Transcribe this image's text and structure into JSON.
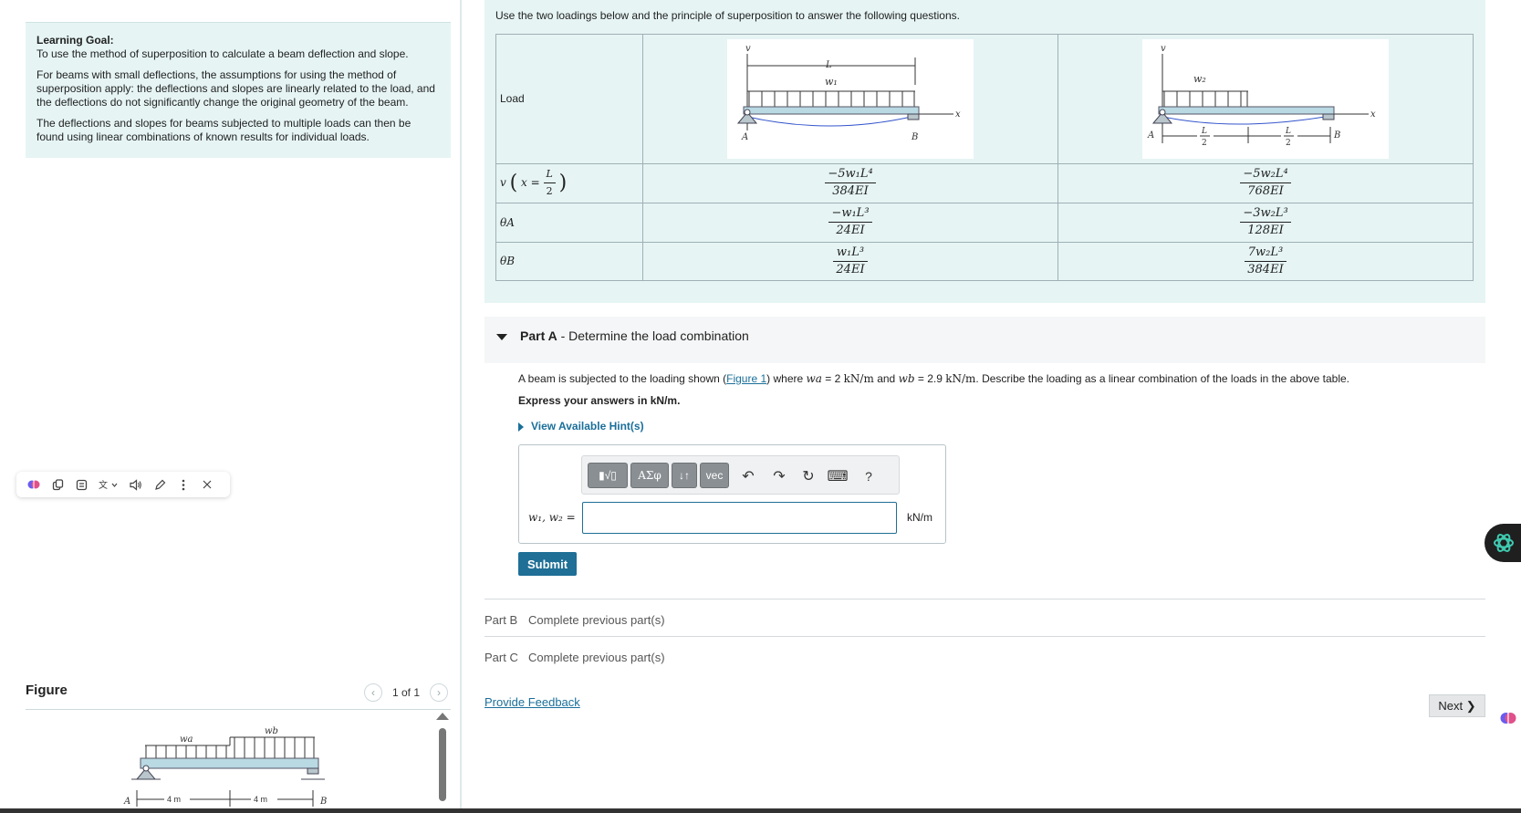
{
  "learning_goal": {
    "title": "Learning Goal:",
    "line1": "To use the method of superposition to calculate a beam deflection and slope.",
    "para2": "For beams with small deflections, the assumptions for using the method of superposition apply: the deflections and slopes are linearly related to the load, and the deflections do not significantly change the original geometry of the beam.",
    "para3": "The deflections and slopes for beams subjected to multiple loads can then be found using linear combinations of known results for individual loads."
  },
  "figure_panel": {
    "title": "Figure",
    "pager": "1 of 1",
    "prev_icon": "‹",
    "next_icon": "›",
    "labels": {
      "wa": "wa",
      "wb": "wb",
      "A": "A",
      "B": "B",
      "dim1": "4 m",
      "dim2": "4 m"
    }
  },
  "intro": {
    "text": "Use the two loadings below and the principle of superposition to answer the following questions."
  },
  "table": {
    "row_load": "Load",
    "row_v": "v",
    "row_v_x": "x =",
    "row_v_num": "L",
    "row_v_den": "2",
    "row_thetaA": "θA",
    "row_thetaB": "θB",
    "col1": {
      "v_num": "−5w₁L⁴",
      "v_den": "384EI",
      "thA_num": "−w₁L³",
      "thA_den": "24EI",
      "thB_num": "w₁L³",
      "thB_den": "24EI",
      "diagram": {
        "v": "v",
        "L": "L",
        "w": "w₁",
        "x": "x",
        "A": "A",
        "B": "B"
      }
    },
    "col2": {
      "v_num": "−5w₂L⁴",
      "v_den": "768EI",
      "thA_num": "−3w₂L³",
      "thA_den": "128EI",
      "thB_num": "7w₂L³",
      "thB_den": "384EI",
      "diagram": {
        "v": "v",
        "w": "w₂",
        "x": "x",
        "A": "A",
        "B": "B",
        "half_num": "L",
        "half_den": "2"
      }
    }
  },
  "partA": {
    "label": "Part A",
    "title": " - Determine the load combination",
    "problem_1": "A beam is subjected to the loading shown (",
    "figure_link": "Figure 1",
    "problem_2": ") where ",
    "wa": "wa",
    "problem_3": " = 2 ",
    "unit": "kN/m",
    "problem_4": " and ",
    "wb": "wb",
    "problem_5": " = 2.9 ",
    "problem_6": ". Describe the loading as a linear combination of the loads in the above table.",
    "express": "Express your answers in kN/m.",
    "hint": "View Available Hint(s)",
    "toolbar": {
      "templates": "▮√▯",
      "greek": "AΣφ",
      "arrows": "↓↑",
      "vec": "vec",
      "undo": "↶",
      "redo": "↷",
      "reset": "↻",
      "keyboard": "⌨",
      "help": "?"
    },
    "answer_label": "w₁, w₂ =",
    "answer_value": "",
    "unit_label": "kN/m",
    "submit": "Submit"
  },
  "partB": {
    "label": "Part B",
    "status": "Complete previous part(s)"
  },
  "partC": {
    "label": "Part C",
    "status": "Complete previous part(s)"
  },
  "feedback": "Provide Feedback",
  "next": "Next ❯",
  "colors": {
    "accent": "#1f6f96",
    "panel": "#e6f4f4",
    "beam": "#b9d9e3"
  }
}
